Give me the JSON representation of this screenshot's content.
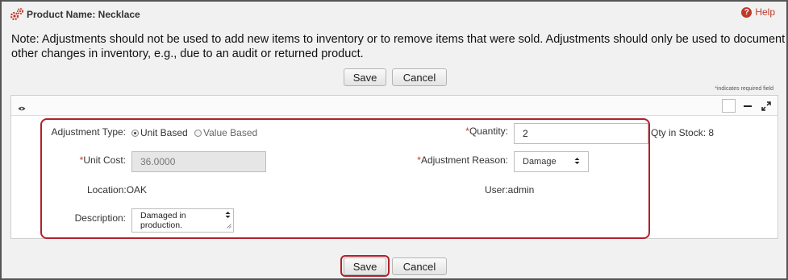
{
  "header": {
    "title": "Product Name: Necklace",
    "help_label": "Help",
    "help_glyph": "?"
  },
  "note": "Note: Adjustments should not be used to add new items to inventory or to remove items that were sold. Adjustments should only be used to document other changes in inventory, e.g., due to an audit or returned product.",
  "actions_top": {
    "save_label": "Save",
    "cancel_label": "Cancel"
  },
  "required_legend": {
    "star": "*",
    "text": "indicates required field"
  },
  "form": {
    "adjustment_type": {
      "label": "Adjustment Type:",
      "options": [
        "Unit Based",
        "Value Based"
      ],
      "selected": "Unit Based"
    },
    "quantity": {
      "star": "*",
      "label": "Quantity:",
      "value": "2"
    },
    "qty_in_stock": "Qty in Stock: 8",
    "unit_cost": {
      "star": "*",
      "label": "Unit Cost:",
      "value": "36.0000"
    },
    "adjustment_reason": {
      "star": "*",
      "label": "Adjustment Reason:",
      "value": "Damage"
    },
    "location": "Location:OAK",
    "user": "User:admin",
    "description": {
      "label": "Description:",
      "line1": "Damaged in",
      "line2": "production."
    }
  },
  "actions_bottom": {
    "save_label": "Save",
    "cancel_label": "Cancel"
  },
  "colors": {
    "accent_red": "#b0212b",
    "gear": "#c0392b"
  },
  "icons": [
    "gears-icon",
    "help-icon",
    "eye-icon",
    "checkbox-icon",
    "minimize-icon",
    "expand-icon",
    "select-arrows-icon",
    "spinner-arrows-icon"
  ]
}
